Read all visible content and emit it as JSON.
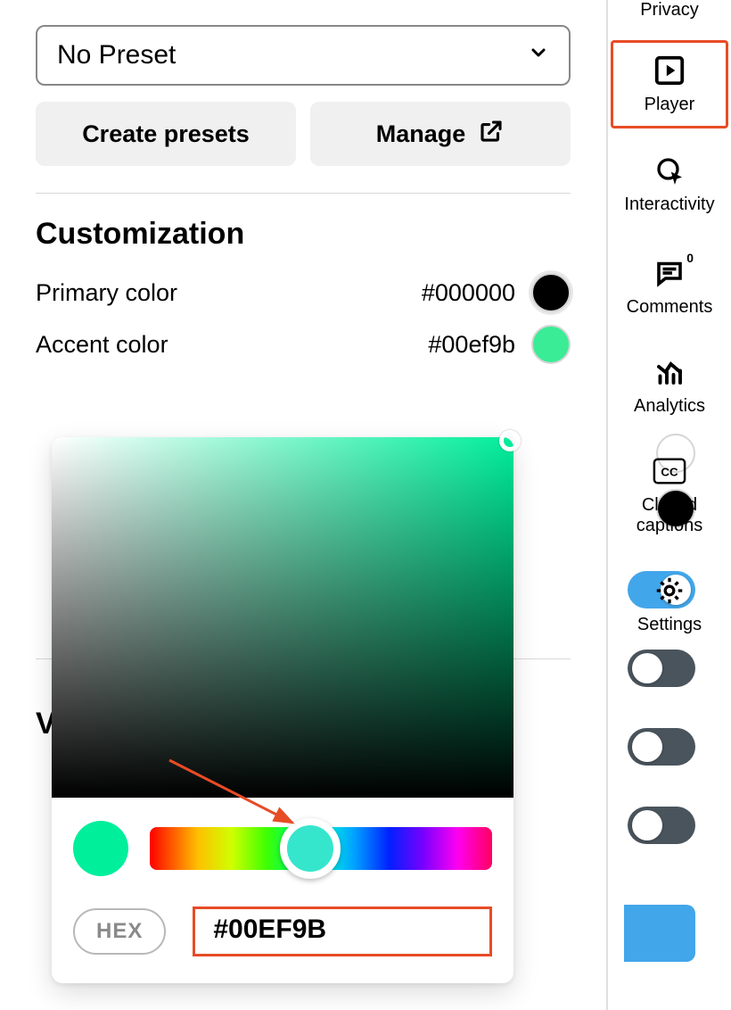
{
  "sidebar": {
    "items": [
      {
        "label": "Privacy"
      },
      {
        "label": "Player"
      },
      {
        "label": "Interactivity"
      },
      {
        "label": "Comments"
      },
      {
        "label": "Analytics"
      },
      {
        "label": "Closed captions"
      },
      {
        "label": "Settings"
      }
    ]
  },
  "preset": {
    "selected": "No Preset",
    "create_label": "Create presets",
    "manage_label": "Manage"
  },
  "customization": {
    "title": "Customization",
    "primary_label": "Primary color",
    "primary_value": "#000000",
    "accent_label": "Accent color",
    "accent_value": "#00ef9b",
    "colors": {
      "primary": "#000000",
      "accent": "#00ef9b",
      "extra_white": "#ffffff",
      "extra_black": "#000000"
    }
  },
  "picker": {
    "hex_label": "HEX",
    "hex_value": "#00EF9B",
    "hue_approx_deg": 159
  },
  "toggles": [
    {
      "name": "toggle-1",
      "on": true
    },
    {
      "name": "toggle-2",
      "on": false
    },
    {
      "name": "toggle-3",
      "on": false
    },
    {
      "name": "toggle-4",
      "on": false
    }
  ],
  "partial_section_start": "V",
  "annotations": {
    "arrow_target": "hue-slider",
    "boxed_items": [
      "sidebar-item-player",
      "hex-value-input"
    ]
  }
}
